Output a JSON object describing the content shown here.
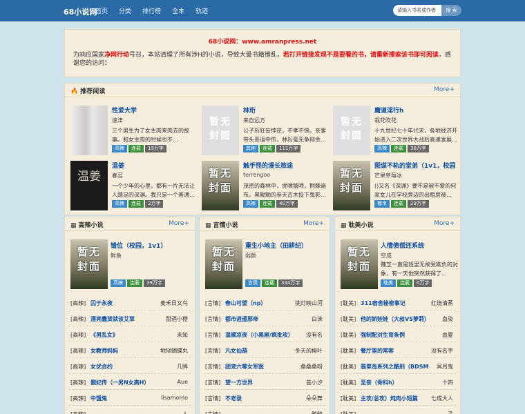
{
  "header": {
    "logo": "68小说网",
    "nav": [
      "首页",
      "分类",
      "排行榜",
      "全本",
      "轨迹"
    ],
    "search_placeholder": "请输入书名或作者",
    "search_button": "搜 索"
  },
  "notice": {
    "site": "68小说网：www.amranpress.net",
    "p1": "为响应国家",
    "p2": "净网行动",
    "p3": "号召，本站清理了所有涉H的小说，导致大量书籍错乱，",
    "p4": "若打开链接发现不是要看的书，请重新搜索该书即可阅读",
    "p5": "，感谢您的访问！"
  },
  "recommend": {
    "title": "推荐阅读",
    "more": "More+",
    "books": [
      {
        "title": "性爱大学",
        "author": "速津",
        "desc": "三个男生为了女主肉来肉去的故事。和女主肉的时候也不…",
        "tags": [
          "高辣",
          "连载",
          "19万字"
        ],
        "cover": "photo"
      },
      {
        "title": "林珩",
        "author": "来自远方",
        "desc": "公子珩狂妄悖逆，不孝不悌。亲爹带头恶语中伤，林珩毫无争辩余…",
        "tags": [
          "其他",
          "连载",
          "111万字"
        ],
        "cover": "none",
        "cover_text": "暂无封面"
      },
      {
        "title": "魔道淫行h",
        "author": "栽花吹花",
        "desc": "十九世纪七十年代末，各地经济开始进入二次世界大战后高速发展…",
        "tags": [
          "高辣",
          "连载",
          "38万字"
        ],
        "cover": "none",
        "cover_text": "暂无封面"
      },
      {
        "title": "温姜",
        "author": "春蕊",
        "desc": "一个少年的心里，都有一片无法让人踏足的深渊。我只是一个普通…",
        "tags": [
          "高辣",
          "连载",
          "2万字"
        ],
        "cover": "dark",
        "cover_text": "温姜"
      },
      {
        "title": "触手怪的漫长旅途",
        "author": "terrengoo",
        "desc": "茂密的森林中，虎啸猿啼，荆棘遍布。黑黝黝的参天古木投下鬼影…",
        "tags": [
          "高辣",
          "连载",
          "40万字"
        ],
        "cover": "paint",
        "cover_text": "暂无封面"
      },
      {
        "title": "图谋不轨的堂弟（1v1，校园",
        "author": "芒果草莓冰",
        "desc": "()又名《深渊》要不是被不爱的何家女儿在学校旁边的出租房被…",
        "tags": [
          "都市",
          "连载",
          "29万字"
        ],
        "cover": "paint",
        "cover_text": "暂无封面"
      }
    ]
  },
  "sections": [
    {
      "title": "高辣小说",
      "more": "More+",
      "feature": {
        "title": "错位（校园，1v1）",
        "author": "鲜鱼",
        "desc": "",
        "tags": [
          "高辣",
          "连载",
          "19万字"
        ],
        "cover_text": "暂无封面"
      },
      "items": [
        {
          "cat": "[高辣]",
          "name": "囚于永夜",
          "author": "麦禾日又鸟"
        },
        {
          "cat": "[高辣]",
          "name": "漂亮蠢货就该艾草",
          "author": "甜酒小橙"
        },
        {
          "cat": "[高辣]",
          "name": "《男乱女》",
          "author": "未知"
        },
        {
          "cat": "[高辣]",
          "name": "女教师妈妈",
          "author": "地狱蝴蝶丸"
        },
        {
          "cat": "[高辣]",
          "name": "女优合约",
          "author": "几眸"
        },
        {
          "cat": "[高辣]",
          "name": "侧妃传（一男N女高H）",
          "author": "Aue"
        },
        {
          "cat": "[高辣]",
          "name": "中饿鬼",
          "author": "lisamomo"
        },
        {
          "cat": "[高辣]",
          "name": "",
          "author": "人"
        }
      ]
    },
    {
      "title": "言情小说",
      "more": "More+",
      "feature": {
        "title": "重生小地主（田耕纪）",
        "author": "弱颜",
        "desc": "",
        "tags": [
          "言情",
          "连载",
          "334万字"
        ],
        "cover_text": "暂无封面"
      },
      "items": [
        {
          "cat": "[言情]",
          "name": "春山可望（np）",
          "author": "挑灯映山河"
        },
        {
          "cat": "[言情]",
          "name": "都市逍遥邪帝",
          "author": "白沫"
        },
        {
          "cat": "[言情]",
          "name": "温顺凉夜（小黑屋/疯批攻）",
          "author": "没有名"
        },
        {
          "cat": "[言情]",
          "name": "凡女仙葫",
          "author": "冬天的柳叶"
        },
        {
          "cat": "[言情]",
          "name": "团宠六零女军医",
          "author": "桑桑桑呀"
        },
        {
          "cat": "[言情]",
          "name": "望一方世界",
          "author": "芸小汐"
        },
        {
          "cat": "[言情]",
          "name": "不老录",
          "author": "朵朵舞"
        },
        {
          "cat": "[言情]",
          "name": "",
          "author": "鸦鸦"
        }
      ]
    },
    {
      "title": "耽美小说",
      "more": "More+",
      "feature": {
        "title": "人情债偿还系统",
        "author": "空成",
        "desc": "魏芝一直是班里无故受欺负的对象，有一天他突然获得了…",
        "tags": [
          "耽美",
          "连载",
          "0万字"
        ],
        "cover_text": "暂无封面"
      },
      "items": [
        {
          "cat": "[耽美]",
          "name": "311宿舍秘密事记",
          "author": "红烧清蒸"
        },
        {
          "cat": "[耽美]",
          "name": "他的娇娃娃（大叔VS萝莉）",
          "author": "血染"
        },
        {
          "cat": "[耽美]",
          "name": "强制配对生育条例",
          "author": "由夏"
        },
        {
          "cat": "[耽美]",
          "name": "餐厅里的常客",
          "author": "没有名字"
        },
        {
          "cat": "[耽美]",
          "name": "翡翠岛系列之酷刑（BDSM",
          "author": "冥月鬼"
        },
        {
          "cat": "[耽美]",
          "name": "至亲（骨科h）",
          "author": "十四"
        },
        {
          "cat": "[耽美]",
          "name": "主攻/总攻）炖肉小短篇",
          "author": "七成大人"
        },
        {
          "cat": "[耽美]",
          "name": "",
          "author": "子"
        }
      ]
    }
  ]
}
